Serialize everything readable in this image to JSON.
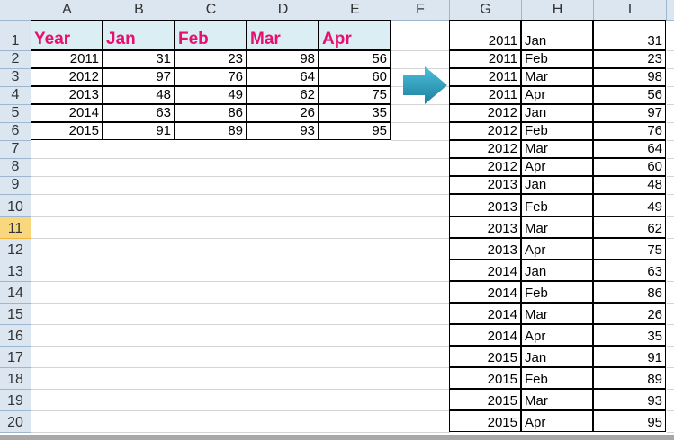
{
  "columns": [
    "A",
    "B",
    "C",
    "D",
    "E",
    "F",
    "G",
    "H",
    "I"
  ],
  "rows": [
    "1",
    "2",
    "3",
    "4",
    "5",
    "6",
    "7",
    "8",
    "9",
    "10",
    "11",
    "12",
    "13",
    "14",
    "15",
    "16",
    "17",
    "18",
    "19",
    "20"
  ],
  "selected_row": "11",
  "source_table": {
    "headers": [
      "Year",
      "Jan",
      "Feb",
      "Mar",
      "Apr"
    ],
    "rows": [
      [
        "2011",
        "31",
        "23",
        "98",
        "56"
      ],
      [
        "2012",
        "97",
        "76",
        "64",
        "60"
      ],
      [
        "2013",
        "48",
        "49",
        "62",
        "75"
      ],
      [
        "2014",
        "63",
        "86",
        "26",
        "35"
      ],
      [
        "2015",
        "91",
        "89",
        "93",
        "95"
      ]
    ]
  },
  "result_table": [
    [
      "2011",
      "Jan",
      "31"
    ],
    [
      "2011",
      "Feb",
      "23"
    ],
    [
      "2011",
      "Mar",
      "98"
    ],
    [
      "2011",
      "Apr",
      "56"
    ],
    [
      "2012",
      "Jan",
      "97"
    ],
    [
      "2012",
      "Feb",
      "76"
    ],
    [
      "2012",
      "Mar",
      "64"
    ],
    [
      "2012",
      "Apr",
      "60"
    ],
    [
      "2013",
      "Jan",
      "48"
    ],
    [
      "2013",
      "Feb",
      "49"
    ],
    [
      "2013",
      "Mar",
      "62"
    ],
    [
      "2013",
      "Apr",
      "75"
    ],
    [
      "2014",
      "Jan",
      "63"
    ],
    [
      "2014",
      "Feb",
      "86"
    ],
    [
      "2014",
      "Mar",
      "26"
    ],
    [
      "2014",
      "Apr",
      "35"
    ],
    [
      "2015",
      "Jan",
      "91"
    ],
    [
      "2015",
      "Feb",
      "89"
    ],
    [
      "2015",
      "Mar",
      "93"
    ],
    [
      "2015",
      "Apr",
      "95"
    ]
  ],
  "colors": {
    "header_text": "#e8106e",
    "header_fill": "#daeef3",
    "arrow": "#2fa3c4",
    "selected_row": "#f9d77e"
  },
  "icons": {
    "arrow": "right-arrow-icon"
  }
}
